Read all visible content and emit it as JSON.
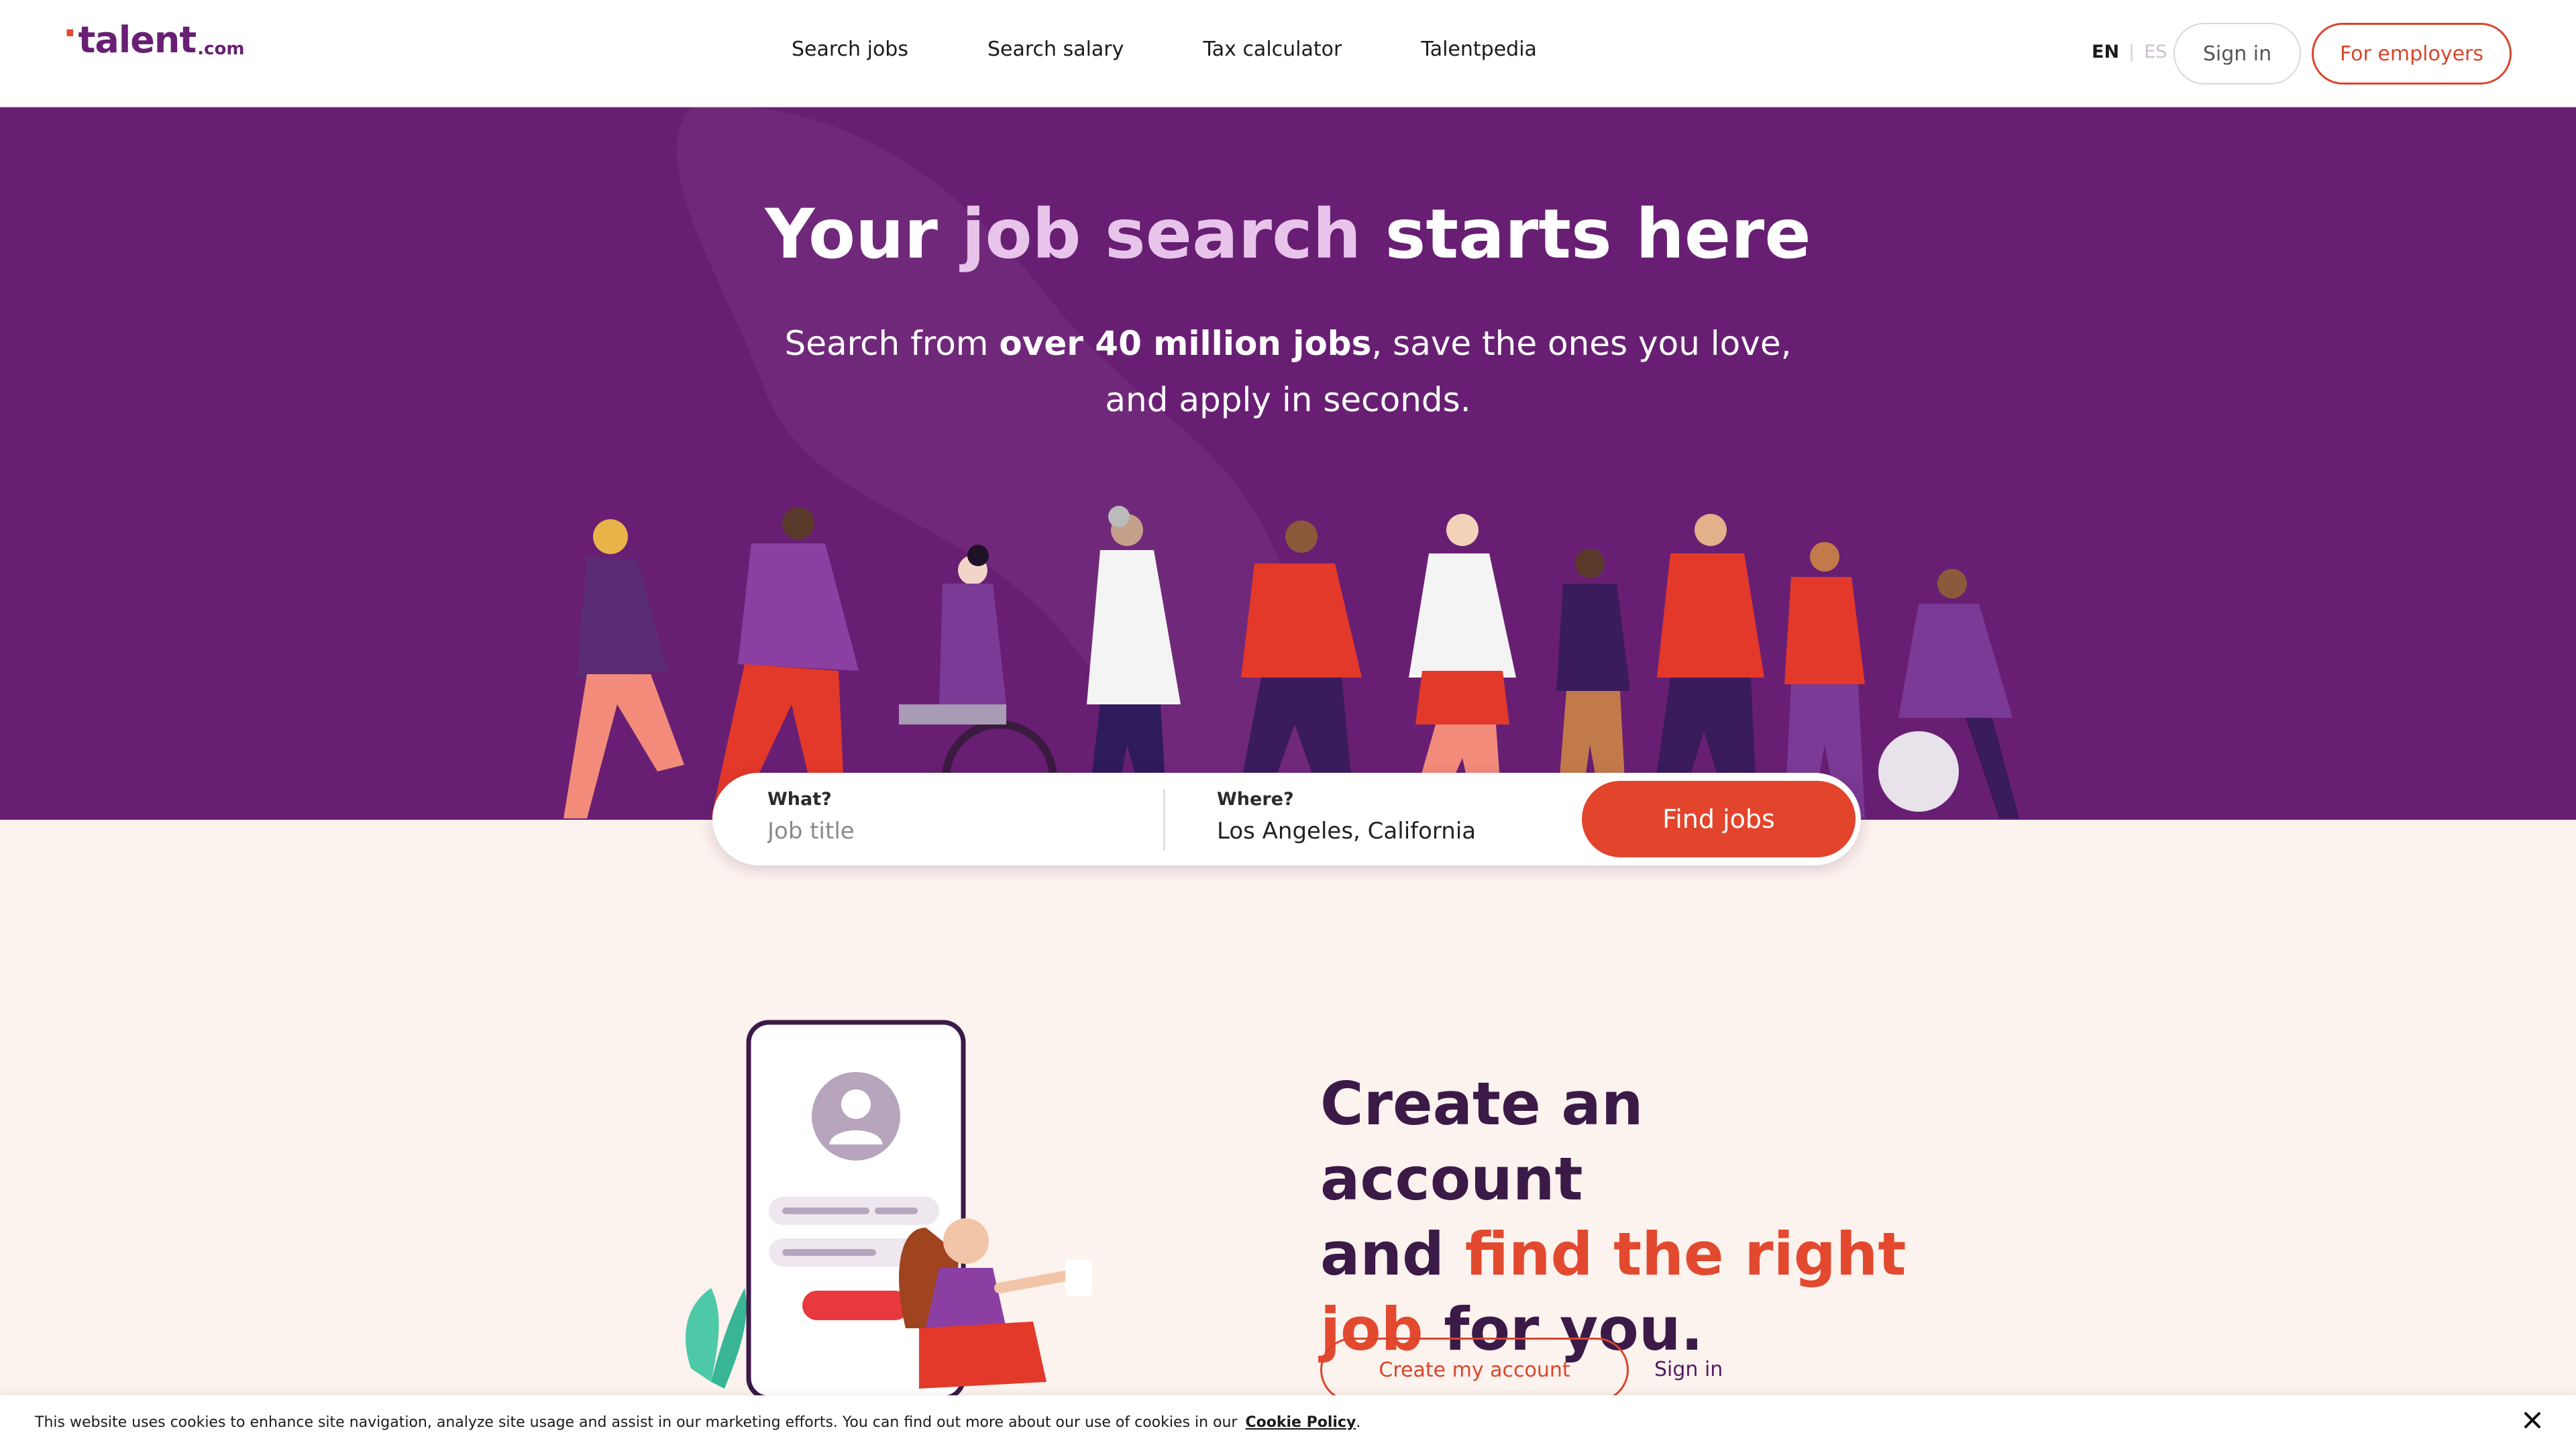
{
  "header": {
    "logo": {
      "dot": "·",
      "text": "talent",
      "suffix": ".com"
    },
    "nav": [
      {
        "label": "Search jobs"
      },
      {
        "label": "Search salary"
      },
      {
        "label": "Tax calculator"
      },
      {
        "label": "Talentpedia"
      }
    ],
    "lang": {
      "active": "EN",
      "separator": "|",
      "inactive": "ES"
    },
    "signin_label": "Sign in",
    "employers_label": "For employers"
  },
  "hero": {
    "title_pre": "Your ",
    "title_highlight": "job search",
    "title_post": " starts here",
    "sub_pre": "Search from ",
    "sub_bold": "over 40 million jobs",
    "sub_mid": ", save the ones you love,",
    "sub_line2": "and apply in seconds."
  },
  "search": {
    "what_label": "What?",
    "what_placeholder": "Job title",
    "where_label": "Where?",
    "where_value": "Los Angeles, California",
    "button_label": "Find jobs"
  },
  "account": {
    "line1": "Create an account",
    "line2_pre": "and ",
    "line2_hl": "find the right",
    "line3_hl": "job",
    "line3_post": " for you.",
    "create_label": "Create my account",
    "signin_label": "Sign in"
  },
  "cookie": {
    "text": "This website uses cookies to enhance site navigation, analyze site usage and assist in our marketing efforts. You can find out more about our use of cookies in our",
    "link": "Cookie Policy",
    "end": "."
  },
  "colors": {
    "brand_purple": "#681f73",
    "accent_red": "#e2452c",
    "highlight_pink": "#e8c4ea",
    "dark_title": "#3b1a47",
    "page_bg": "#fcf2ee"
  },
  "icons": {
    "close": "close-icon",
    "avatar": "avatar-icon"
  }
}
